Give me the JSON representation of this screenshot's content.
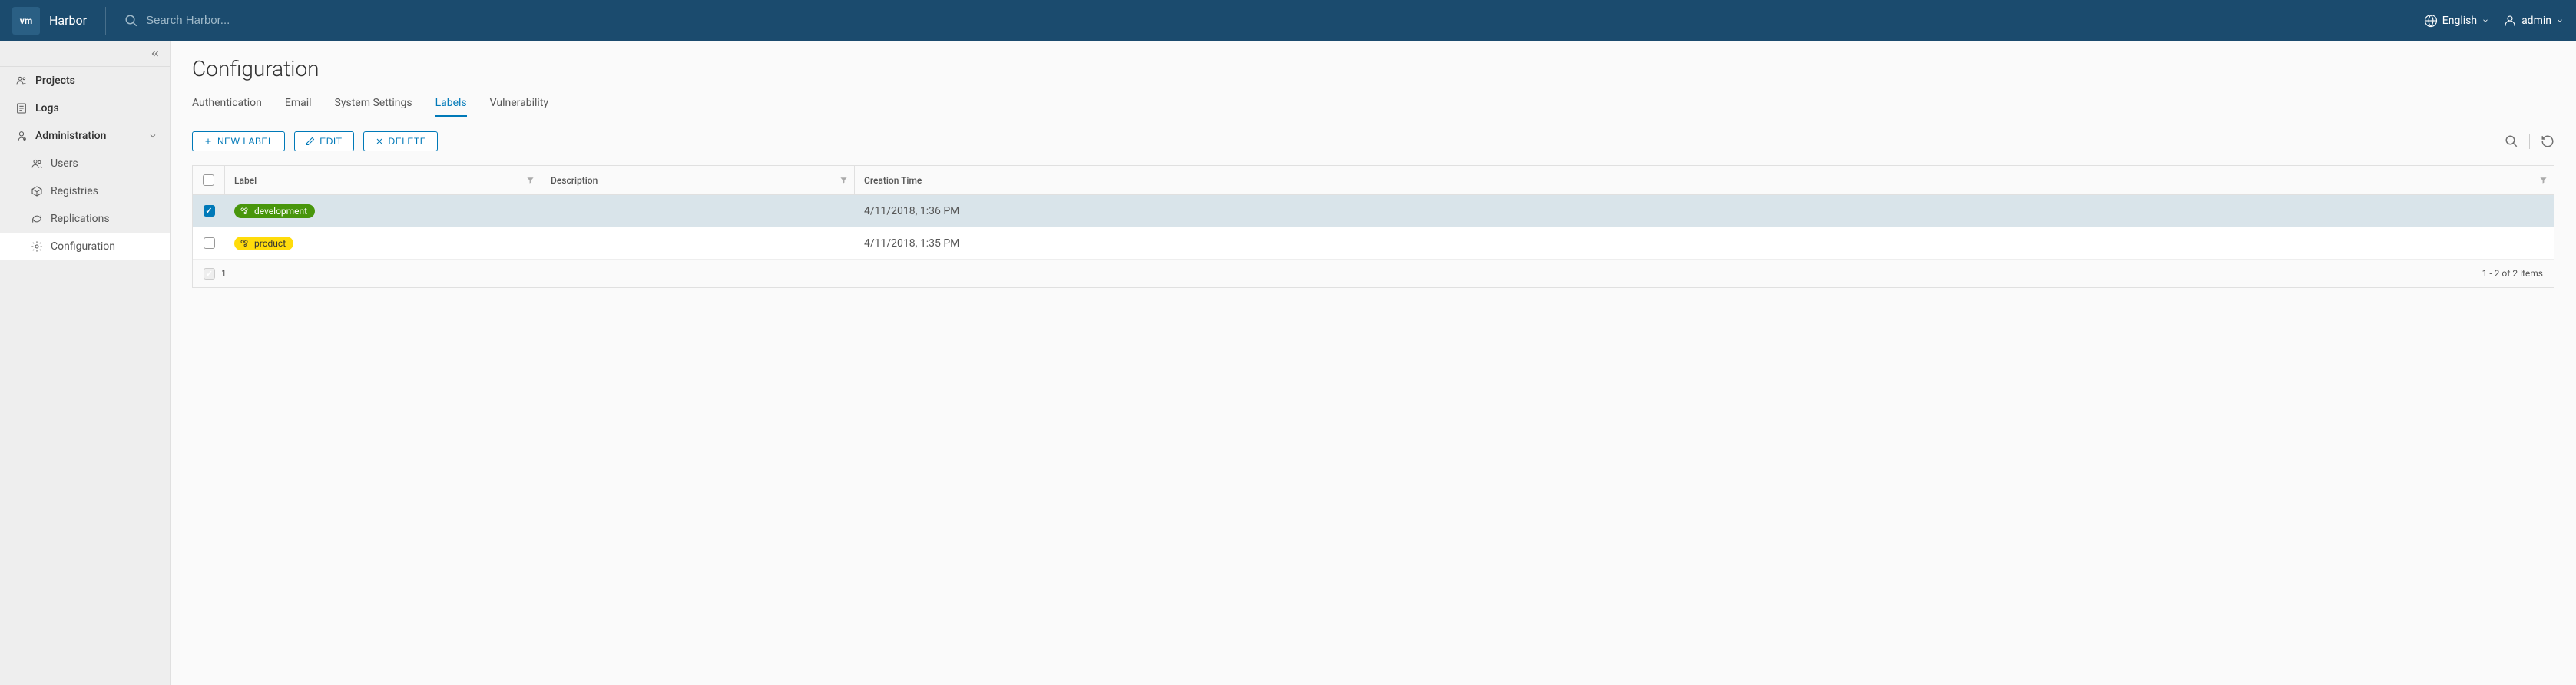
{
  "header": {
    "logo_small": "vm",
    "app_name": "Harbor",
    "search_placeholder": "Search Harbor...",
    "language": "English",
    "user": "admin"
  },
  "sidebar": {
    "items": [
      {
        "label": "Projects"
      },
      {
        "label": "Logs"
      },
      {
        "label": "Administration"
      }
    ],
    "admin_children": [
      {
        "label": "Users"
      },
      {
        "label": "Registries"
      },
      {
        "label": "Replications"
      },
      {
        "label": "Configuration"
      }
    ]
  },
  "page": {
    "title": "Configuration",
    "tabs": [
      {
        "label": "Authentication"
      },
      {
        "label": "Email"
      },
      {
        "label": "System Settings"
      },
      {
        "label": "Labels"
      },
      {
        "label": "Vulnerability"
      }
    ]
  },
  "toolbar": {
    "new_label": "New Label",
    "edit": "Edit",
    "delete": "Delete"
  },
  "table": {
    "columns": {
      "label": "Label",
      "description": "Description",
      "creation_time": "Creation Time"
    },
    "rows": [
      {
        "label": "development",
        "description": "",
        "creation_time": "4/11/2018, 1:36 PM",
        "selected": true,
        "color": "green"
      },
      {
        "label": "product",
        "description": "",
        "creation_time": "4/11/2018, 1:35 PM",
        "selected": false,
        "color": "yellow"
      }
    ],
    "footer": {
      "selected_count": "1",
      "range": "1 - 2 of 2 items"
    }
  },
  "colors": {
    "header_bg": "#1b4b6e",
    "primary": "#0079b8",
    "green": "#48960c",
    "yellow": "#ffdc0b"
  }
}
